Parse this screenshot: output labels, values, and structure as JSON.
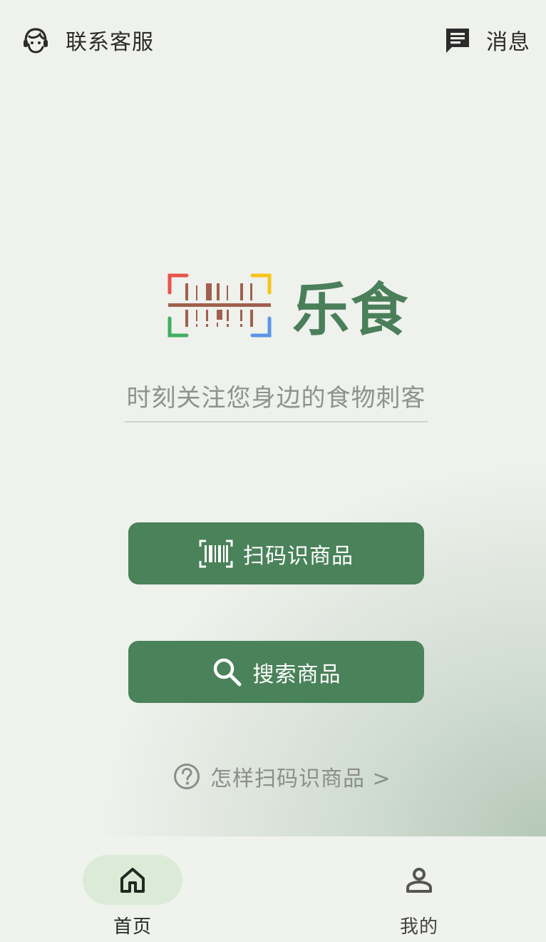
{
  "topbar": {
    "customer_service_label": "联系客服",
    "customer_service_icon": "headset-icon",
    "messages_label": "消息",
    "messages_icon": "message-icon"
  },
  "brand": {
    "name": "乐食",
    "logo_icon": "barcode-scan-logo",
    "slogan": "时刻关注您身边的食物刺客"
  },
  "actions": {
    "scan_label": "扫码识商品",
    "scan_icon": "barcode-icon",
    "search_label": "搜索商品",
    "search_icon": "search-icon",
    "help_label": "怎样扫码识商品 >",
    "help_icon": "question-circle-icon"
  },
  "bottom_nav": {
    "items": [
      {
        "label": "首页",
        "icon": "home-icon",
        "active": true
      },
      {
        "label": "我的",
        "icon": "person-icon",
        "active": false
      }
    ]
  },
  "colors": {
    "accent": "#4a8259",
    "brand_text": "#4a7f5a",
    "background": "#eff1ec",
    "active_nav_pill": "#dcebd8",
    "logo_bars": "#a0604d",
    "logo_corner_red": "#e8534a",
    "logo_corner_yellow": "#f5c518",
    "logo_corner_green": "#3fae63",
    "logo_corner_blue": "#5a95e8"
  }
}
